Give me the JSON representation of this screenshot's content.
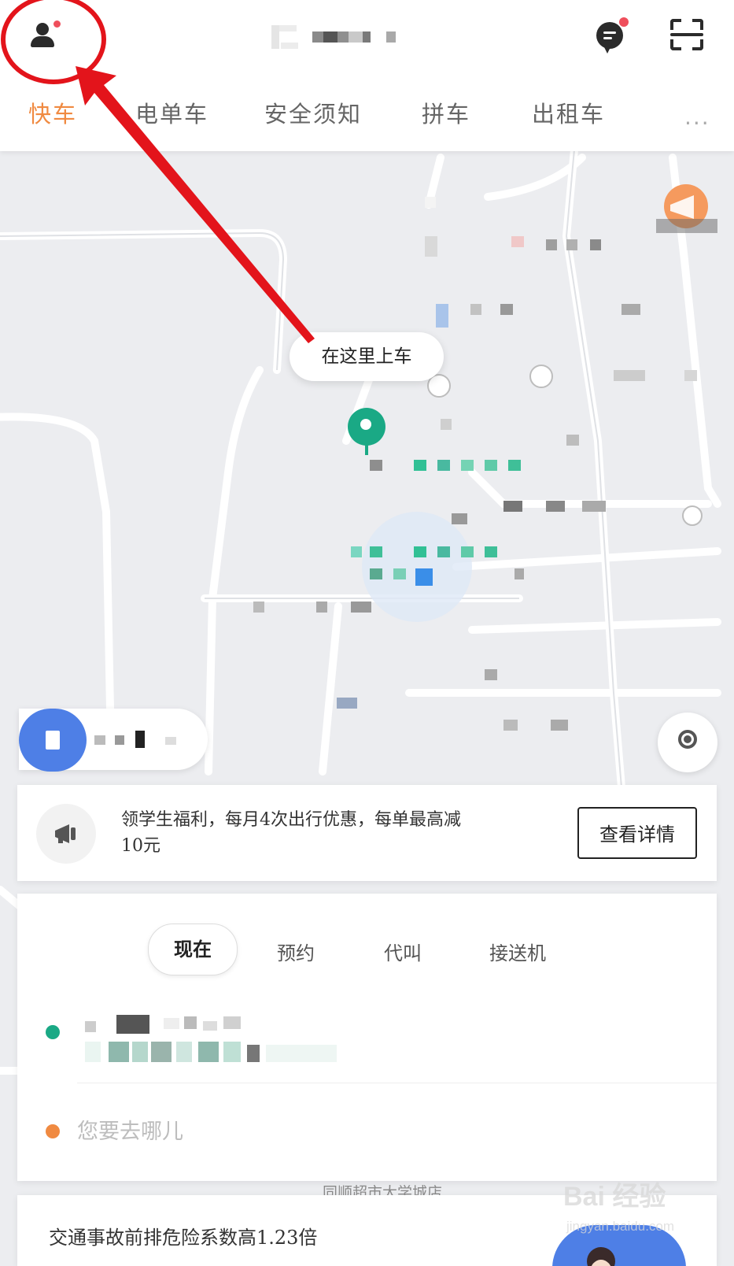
{
  "header": {
    "profile_icon": "user-icon",
    "message_icon": "message-icon",
    "scan_icon": "scan-icon",
    "badge_color": "#ef4f5c"
  },
  "tabs": [
    {
      "label": "快车",
      "active": true
    },
    {
      "label": "电单车",
      "active": false
    },
    {
      "label": "安全须知",
      "active": false
    },
    {
      "label": "拼车",
      "active": false
    },
    {
      "label": "出租车",
      "active": false
    }
  ],
  "more_label": "···",
  "map": {
    "pickup_tip": "在这里上车",
    "pin_color": "#1aa985",
    "label_bottom": "同顺超市大学城店"
  },
  "notice": {
    "text": "领学生福利，每月4次出行优惠，每单最高减10元",
    "button": "查看详情"
  },
  "order": {
    "time_tabs": [
      "现在",
      "预约",
      "代叫",
      "接送机"
    ],
    "destination_placeholder": "您要去哪儿"
  },
  "safety": {
    "text": "交通事故前排危险系数高1.23倍"
  },
  "watermark": {
    "logo": "Bai 经验",
    "url": "jingyan.baidu.com"
  },
  "colors": {
    "accent": "#f08a41",
    "green": "#1aa985",
    "annotation": "#e3141b"
  }
}
